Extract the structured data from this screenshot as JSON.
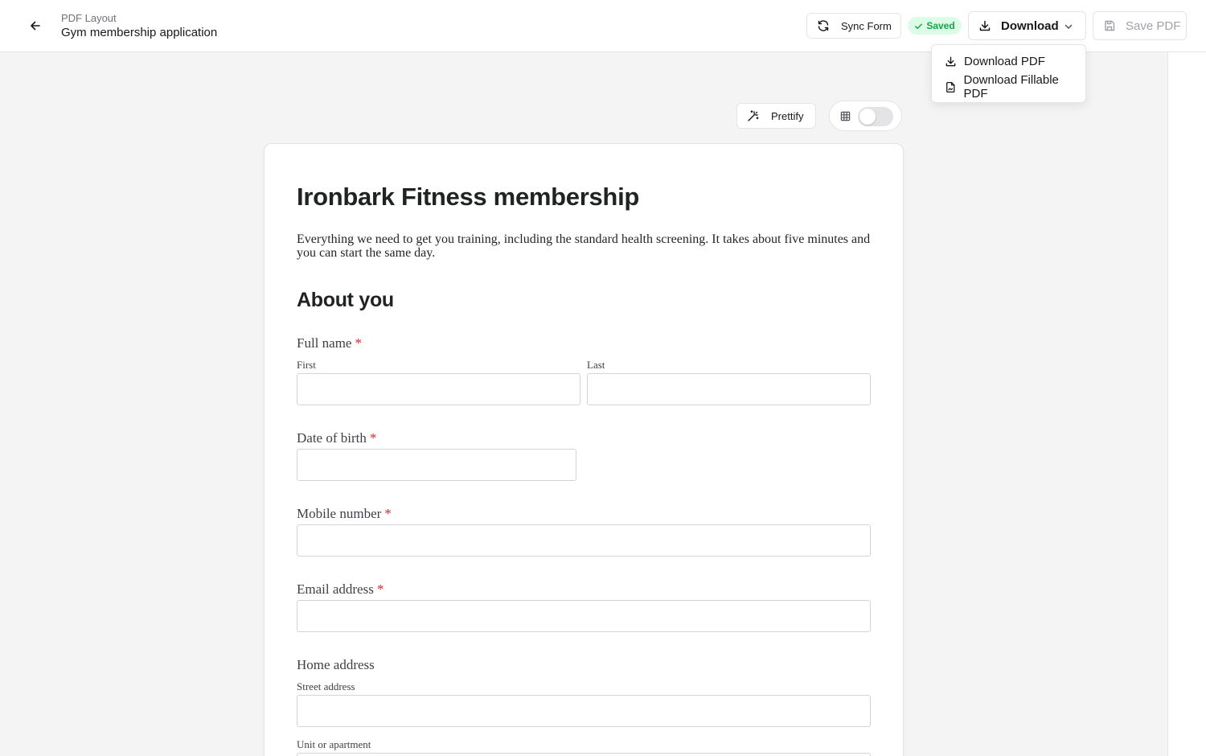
{
  "header": {
    "breadcrumb": "PDF Layout",
    "title": "Gym membership application",
    "sync_label": "Sync Form",
    "saved_label": "Saved",
    "download_label": "Download",
    "save_pdf_label": "Save PDF"
  },
  "download_menu": {
    "items": [
      {
        "label": "Download PDF",
        "icon": "download-icon"
      },
      {
        "label": "Download Fillable PDF",
        "icon": "file-signature-icon"
      }
    ]
  },
  "toolbar": {
    "prettify_label": "Prettify",
    "grid_toggle_on": false
  },
  "form": {
    "title": "Ironbark Fitness membership",
    "description": "Everything we need to get you training, including the standard health screening. It takes about five minutes and you can start the same day.",
    "section_title": "About you",
    "required_marker": "*",
    "full_name": {
      "label": "Full name",
      "first_label": "First",
      "last_label": "Last",
      "first_value": "",
      "last_value": ""
    },
    "dob": {
      "label": "Date of birth",
      "value": ""
    },
    "mobile": {
      "label": "Mobile number",
      "value": ""
    },
    "email": {
      "label": "Email address",
      "value": ""
    },
    "address": {
      "label": "Home address",
      "street_label": "Street address",
      "unit_label": "Unit or apartment",
      "street_value": ""
    }
  },
  "colors": {
    "saved_bg": "#dcfce7",
    "saved_text": "#16a34a",
    "required": "#dc2626"
  }
}
